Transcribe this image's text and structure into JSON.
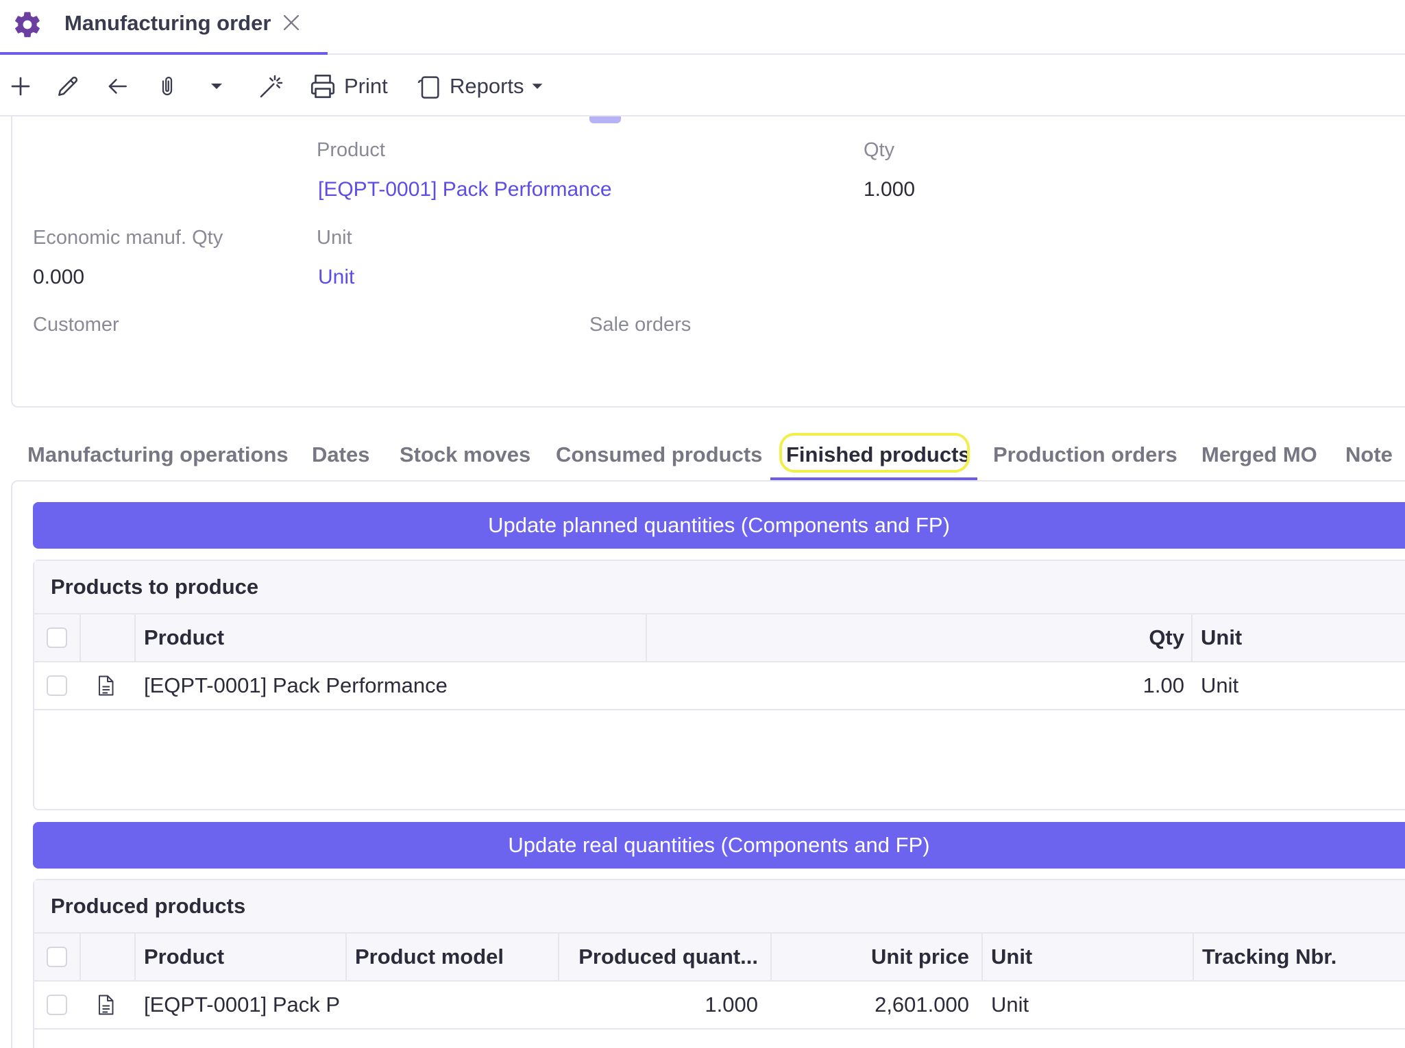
{
  "tab": {
    "title": "Manufacturing order",
    "icon": "gear-icon"
  },
  "toolbar": {
    "print_label": "Print",
    "reports_label": "Reports"
  },
  "form": {
    "product_label": "Product",
    "product_value": "[EQPT-0001] Pack Performance",
    "qty_label": "Qty",
    "qty_value": "1.000",
    "econ_label": "Economic manuf. Qty",
    "econ_value": "0.000",
    "unit_label": "Unit",
    "unit_value": "Unit",
    "customer_label": "Customer",
    "sale_orders_label": "Sale orders"
  },
  "section_tabs": [
    {
      "label": "Manufacturing operations",
      "active": false
    },
    {
      "label": "Dates",
      "active": false
    },
    {
      "label": "Stock moves",
      "active": false
    },
    {
      "label": "Consumed products",
      "active": false
    },
    {
      "label": "Finished products",
      "active": true
    },
    {
      "label": "Production orders",
      "active": false
    },
    {
      "label": "Merged MO",
      "active": false
    },
    {
      "label": "Note",
      "active": false
    }
  ],
  "planned_button": "Update planned quantities (Components and FP)",
  "real_button": "Update real quantities (Components and FP)",
  "to_produce": {
    "title": "Products to produce",
    "columns": {
      "product": "Product",
      "qty": "Qty",
      "unit": "Unit"
    },
    "rows": [
      {
        "product": "[EQPT-0001] Pack Performance",
        "qty": "1.00",
        "unit": "Unit"
      }
    ]
  },
  "produced": {
    "title": "Produced products",
    "columns": {
      "product": "Product",
      "model": "Product model",
      "produced_qty": "Produced quant...",
      "unit_price": "Unit price",
      "unit": "Unit",
      "tracking": "Tracking Nbr."
    },
    "rows": [
      {
        "product": "[EQPT-0001] Pack P",
        "model": "",
        "produced_qty": "1.000",
        "unit_price": "2,601.000",
        "unit": "Unit",
        "tracking": ""
      }
    ]
  },
  "colors": {
    "accent": "#6c5ce7",
    "button": "#6c63ee",
    "link": "#5b4de6",
    "highlight": "#f2ee4a"
  }
}
